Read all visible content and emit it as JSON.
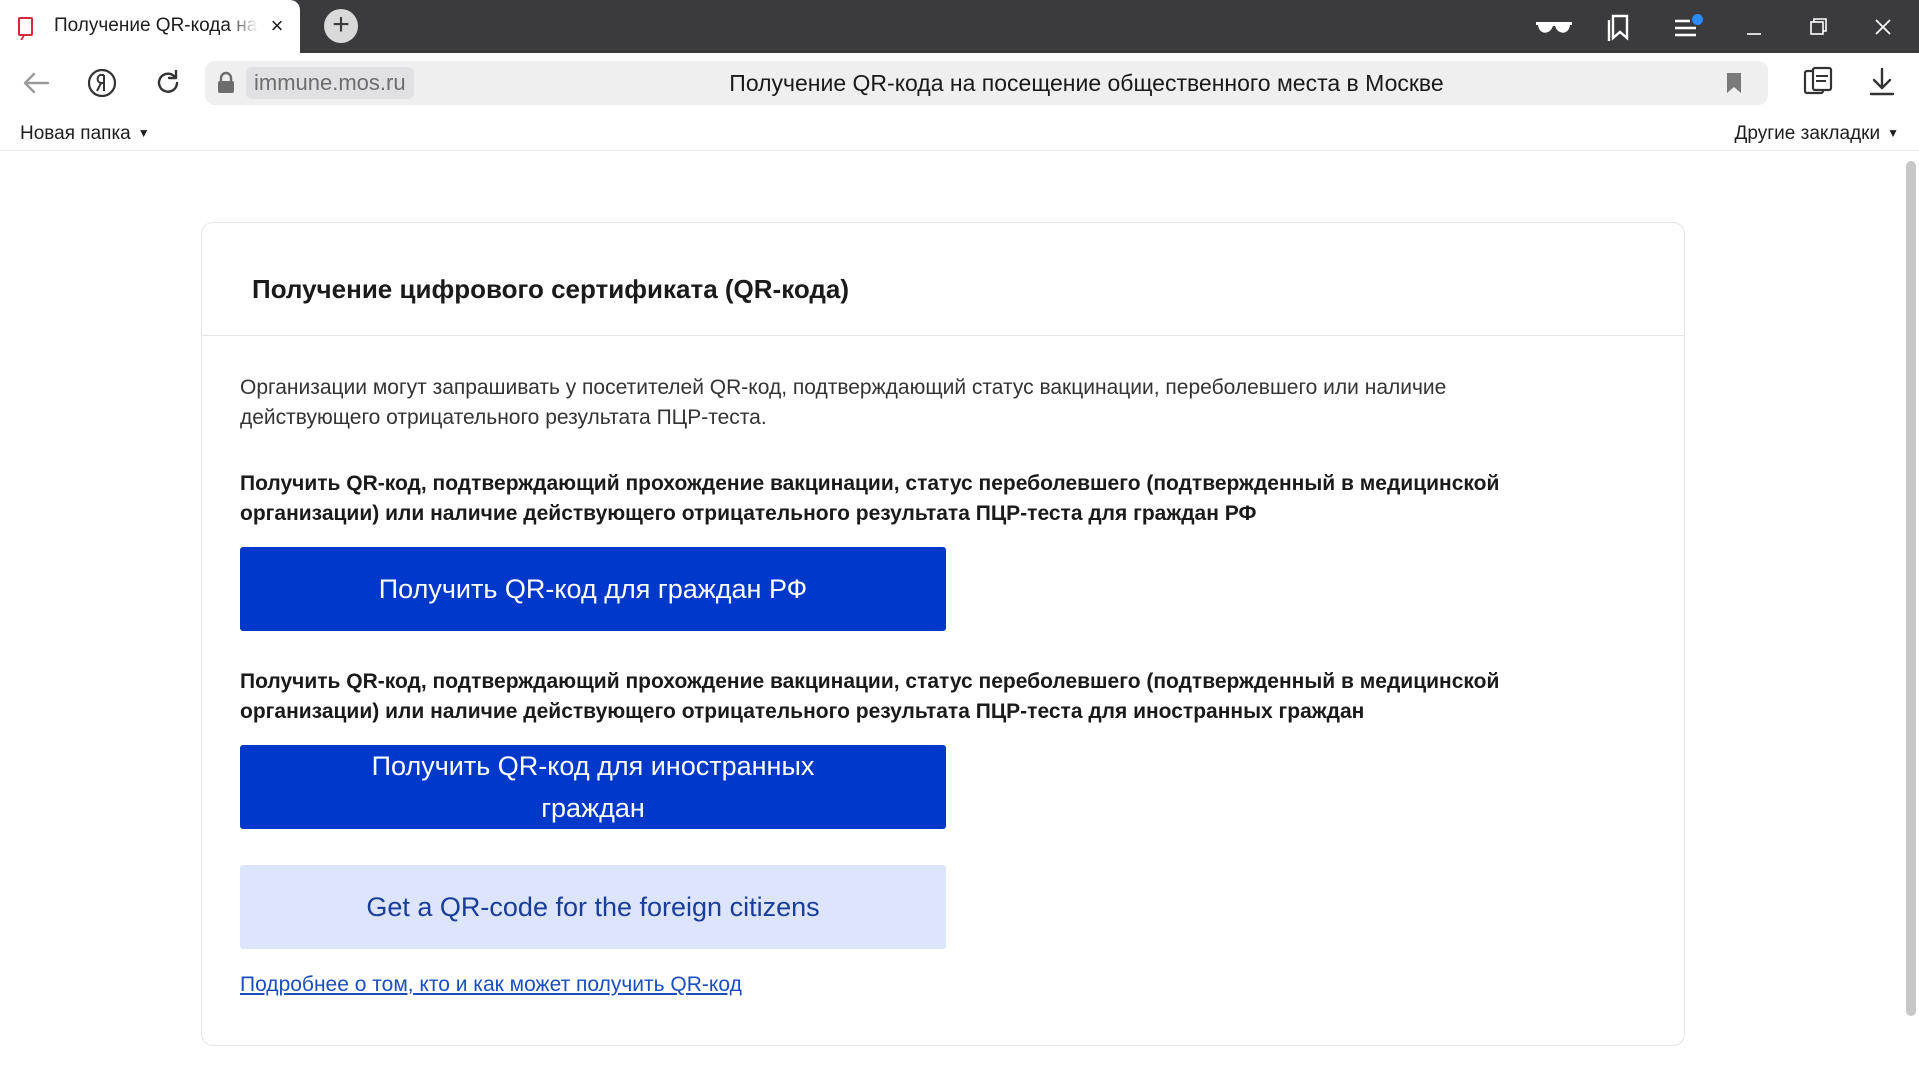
{
  "browser": {
    "tab": {
      "title": "Получение QR-кода на посещение общественного места в Москве",
      "close": "×",
      "favicon": "yandex-page-icon"
    },
    "new_tab_label": "+",
    "window_icons": [
      "glasses-icon",
      "collections-icon",
      "menu-icon",
      "minimize-icon",
      "maximize-icon",
      "close-icon"
    ],
    "address_bar": {
      "domain": "immune.mos.ru",
      "page_title": "Получение QR-кода на посещение общественного места в Москве"
    },
    "bookmarks_bar": {
      "left_folder": "Новая папка",
      "right_folder": "Другие закладки",
      "caret": "▼"
    },
    "accent_color": "#2a8cff"
  },
  "page": {
    "title": "Получение цифрового сертификата (QR-кода)",
    "intro": "Организации могут запрашивать у посетителей QR-код, подтверждающий статус вакцинации, переболевшего или наличие действующего отрицательного результата ПЦР-теста.",
    "section_ru": "Получить QR-код, подтверждающий прохождение вакцинации, статус переболевшего (подтвержденный в медицинской организации) или наличие действующего отрицательного результата ПЦР-теста для граждан РФ",
    "button_ru": "Получить QR-код для граждан РФ",
    "section_foreign": "Получить QR-код, подтверждающий прохождение вакцинации, статус переболевшего (подтвержденный в медицинской организации) или наличие действующего отрицательного результата ПЦР-теста для иностранных граждан",
    "button_foreign": "Получить QR-код для иностранных граждан",
    "button_foreign_en": "Get a QR-code for the foreign citizens",
    "more_link": "Подробнее о том, кто и как может получить QR-код",
    "colors": {
      "primary_button": "#0039c9",
      "secondary_button": "#dce5fc",
      "link": "#1b4fbf"
    }
  }
}
